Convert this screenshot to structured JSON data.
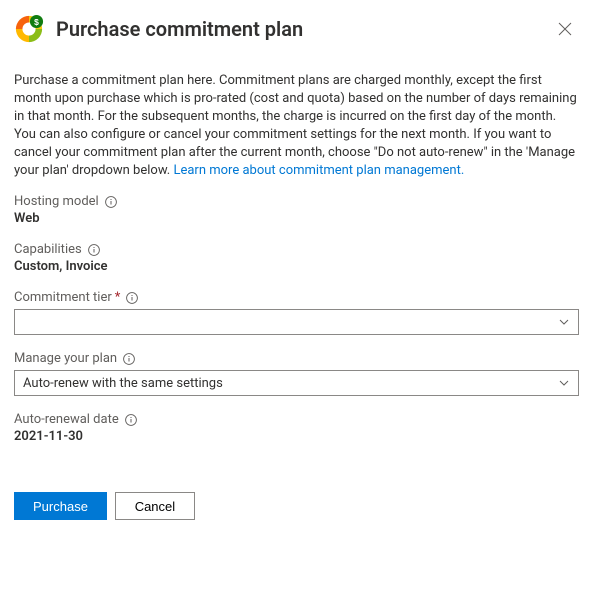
{
  "header": {
    "title": "Purchase commitment plan"
  },
  "description": {
    "text": "Purchase a commitment plan here. Commitment plans are charged monthly, except the first month upon purchase which is pro-rated (cost and quota) based on the number of days remaining in that month. For the subsequent months, the charge is incurred on the first day of the month. You can also configure or cancel your commitment settings for the next month. If you want to cancel your commitment plan after the current month, choose \"Do not auto-renew\" in the 'Manage your plan' dropdown below. ",
    "link_text": "Learn more about commitment plan management."
  },
  "fields": {
    "hosting_model": {
      "label": "Hosting model",
      "value": "Web"
    },
    "capabilities": {
      "label": "Capabilities",
      "value": "Custom, Invoice"
    },
    "commitment_tier": {
      "label": "Commitment tier",
      "value": ""
    },
    "manage_plan": {
      "label": "Manage your plan",
      "value": "Auto-renew with the same settings"
    },
    "auto_renewal_date": {
      "label": "Auto-renewal date",
      "value": "2021-11-30"
    }
  },
  "footer": {
    "purchase": "Purchase",
    "cancel": "Cancel"
  }
}
